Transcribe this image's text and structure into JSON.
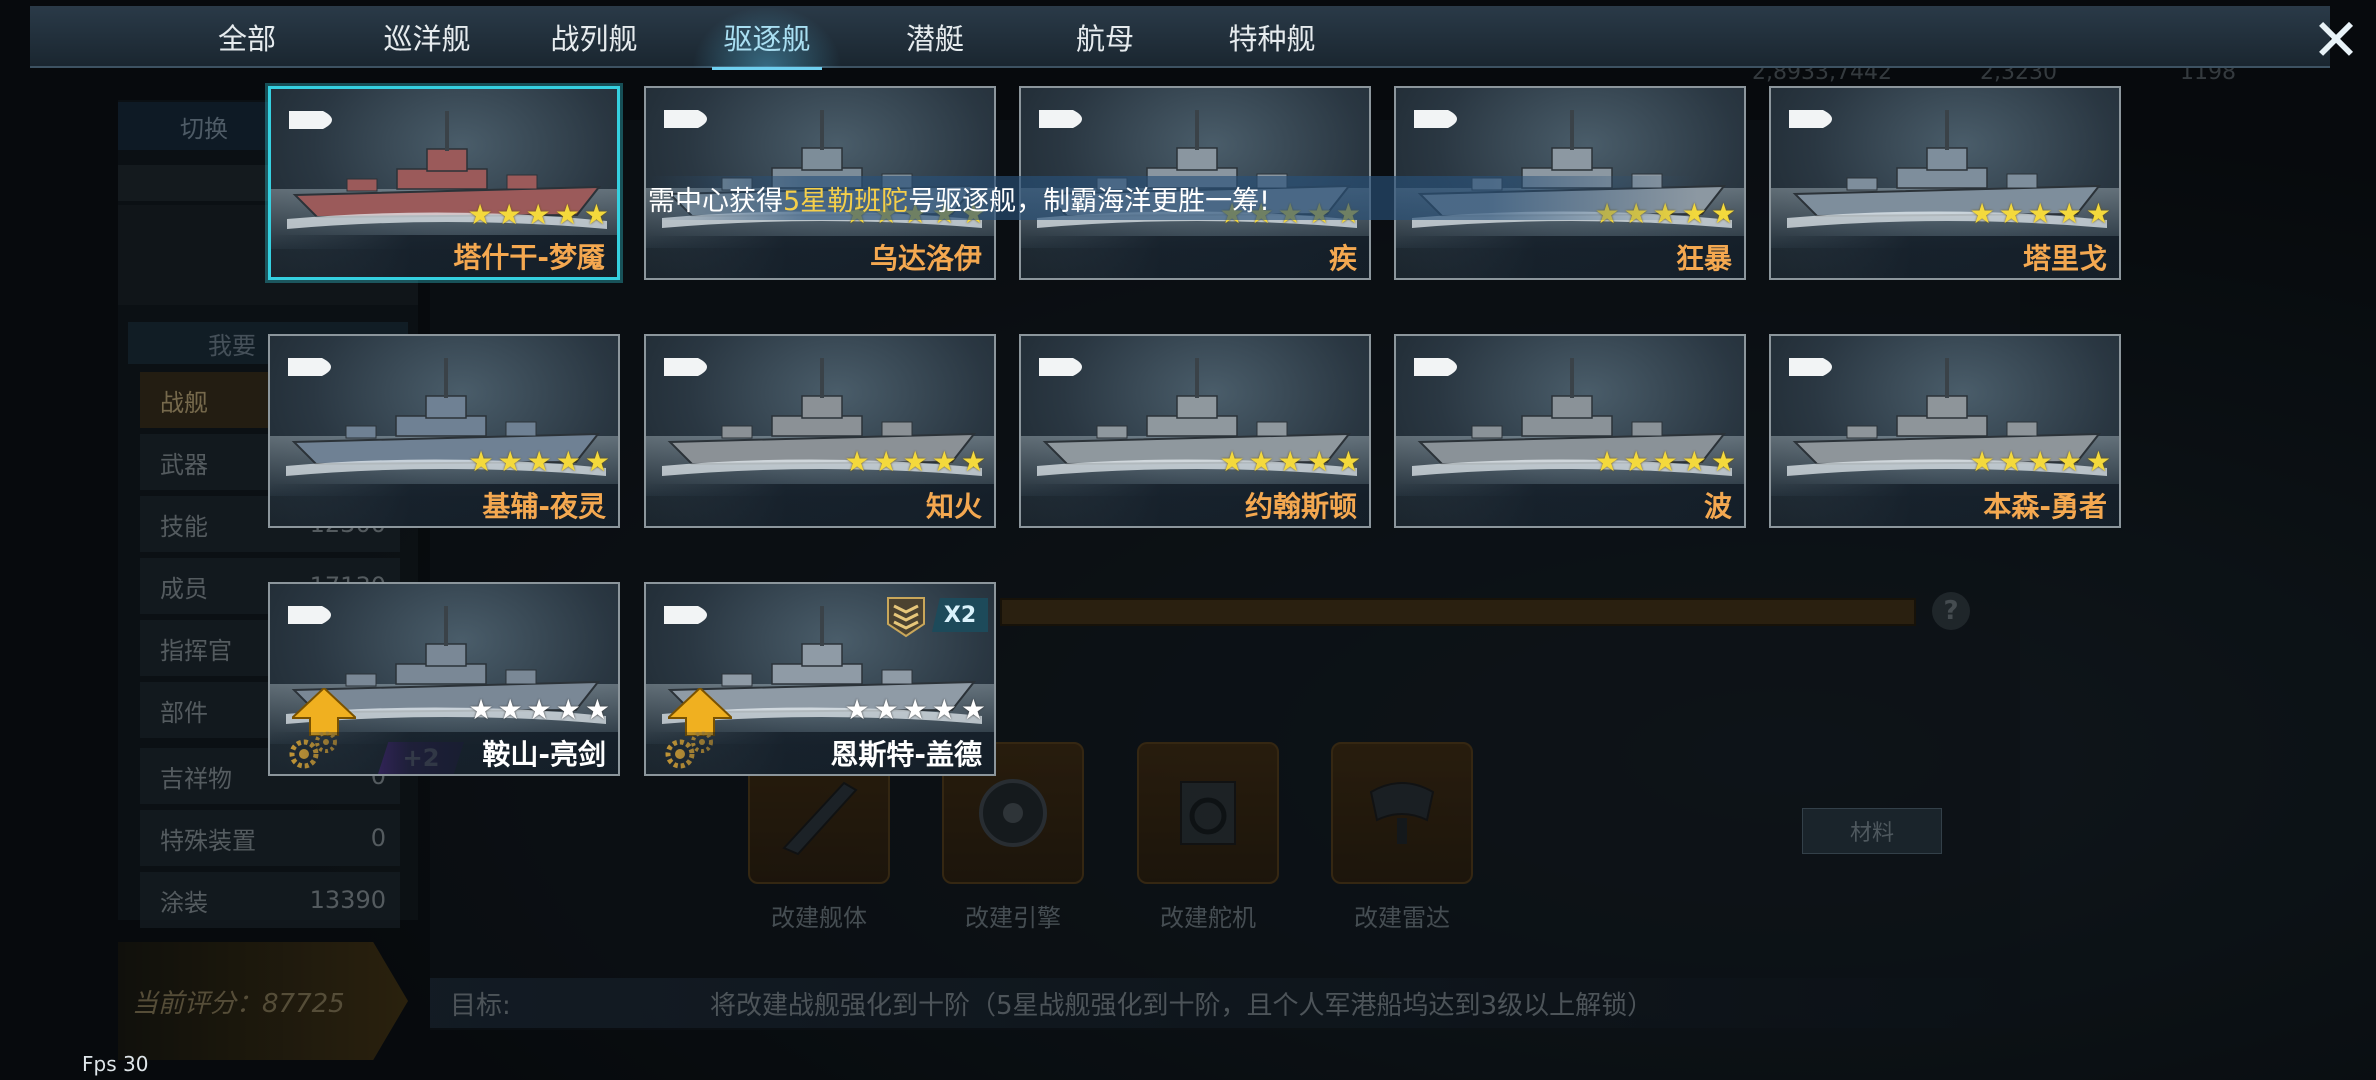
{
  "tabs": [
    {
      "label": "全部",
      "active": false
    },
    {
      "label": "巡洋舰",
      "active": false
    },
    {
      "label": "战列舰",
      "active": false
    },
    {
      "label": "驱逐舰",
      "active": true
    },
    {
      "label": "潜艇",
      "active": false
    },
    {
      "label": "航母",
      "active": false
    },
    {
      "label": "特种舰",
      "active": false
    }
  ],
  "close_icon": "close-icon",
  "notice": {
    "prefix": "需中心获得",
    "highlight": "5星勒班陀",
    "suffix": "号驱逐舰，制霸海洋更胜一筹!"
  },
  "ships": [
    {
      "name": "塔什干-梦魇",
      "stars": 5,
      "stars_filled": 5,
      "selected": true,
      "name_color": "#f4a850"
    },
    {
      "name": "乌达洛伊",
      "stars": 5,
      "stars_filled": 5,
      "selected": false,
      "name_color": "#f4a850"
    },
    {
      "name": "疾",
      "stars": 5,
      "stars_filled": 5,
      "selected": false,
      "name_color": "#f4a850"
    },
    {
      "name": "狂暴",
      "stars": 5,
      "stars_filled": 5,
      "selected": false,
      "name_color": "#f4a850"
    },
    {
      "name": "塔里戈",
      "stars": 5,
      "stars_filled": 5,
      "selected": false,
      "name_color": "#f4a850"
    },
    {
      "name": "基辅-夜灵",
      "stars": 5,
      "stars_filled": 5,
      "selected": false,
      "name_color": "#f4a850"
    },
    {
      "name": "知火",
      "stars": 5,
      "stars_filled": 5,
      "selected": false,
      "name_color": "#f4a850"
    },
    {
      "name": "约翰斯顿",
      "stars": 5,
      "stars_filled": 5,
      "selected": false,
      "name_color": "#f4a850"
    },
    {
      "name": "波",
      "stars": 5,
      "stars_filled": 5,
      "selected": false,
      "name_color": "#f4a850"
    },
    {
      "name": "本森-勇者",
      "stars": 5,
      "stars_filled": 5,
      "selected": false,
      "name_color": "#f4a850"
    },
    {
      "name": "鞍山-亮剑",
      "stars": 5,
      "stars_filled": 0,
      "selected": false,
      "name_color": "#ffffff",
      "upgradable": true,
      "plus": "+2"
    },
    {
      "name": "恩斯特-盖德",
      "stars": 5,
      "stars_filled": 0,
      "selected": false,
      "name_color": "#ffffff",
      "upgradable": true,
      "count": "X2",
      "rank_icon": "veteran-rank-icon"
    }
  ],
  "background": {
    "top_numbers": [
      "2,8933,7442",
      "2,3230",
      "1198"
    ],
    "switch_label": "切换",
    "want_label": "我要",
    "stats": [
      {
        "label": "战舰",
        "value": ""
      },
      {
        "label": "武器",
        "value": ""
      },
      {
        "label": "技能",
        "value": "12300"
      },
      {
        "label": "成员",
        "value": "17130"
      },
      {
        "label": "指挥官",
        "value": ""
      },
      {
        "label": "部件",
        "value": ""
      },
      {
        "label": "吉祥物",
        "value": "0"
      },
      {
        "label": "特殊装置",
        "value": "0"
      },
      {
        "label": "涂装",
        "value": "13390"
      }
    ],
    "upgrades": [
      {
        "label": "改建舰体",
        "icon": "hull-icon"
      },
      {
        "label": "改建引擎",
        "icon": "engine-icon"
      },
      {
        "label": "改建舵机",
        "icon": "steering-icon"
      },
      {
        "label": "改建雷达",
        "icon": "radar-icon"
      }
    ],
    "material_label": "材料",
    "target_label": "目标:",
    "target_text": "将改建战舰强化到十阶（5星战舰强化到十阶，且个人军港船坞达到3级以上解锁）",
    "score_label": "当前评分：87725",
    "help_icon": "help-icon"
  },
  "fps": "Fps 30"
}
